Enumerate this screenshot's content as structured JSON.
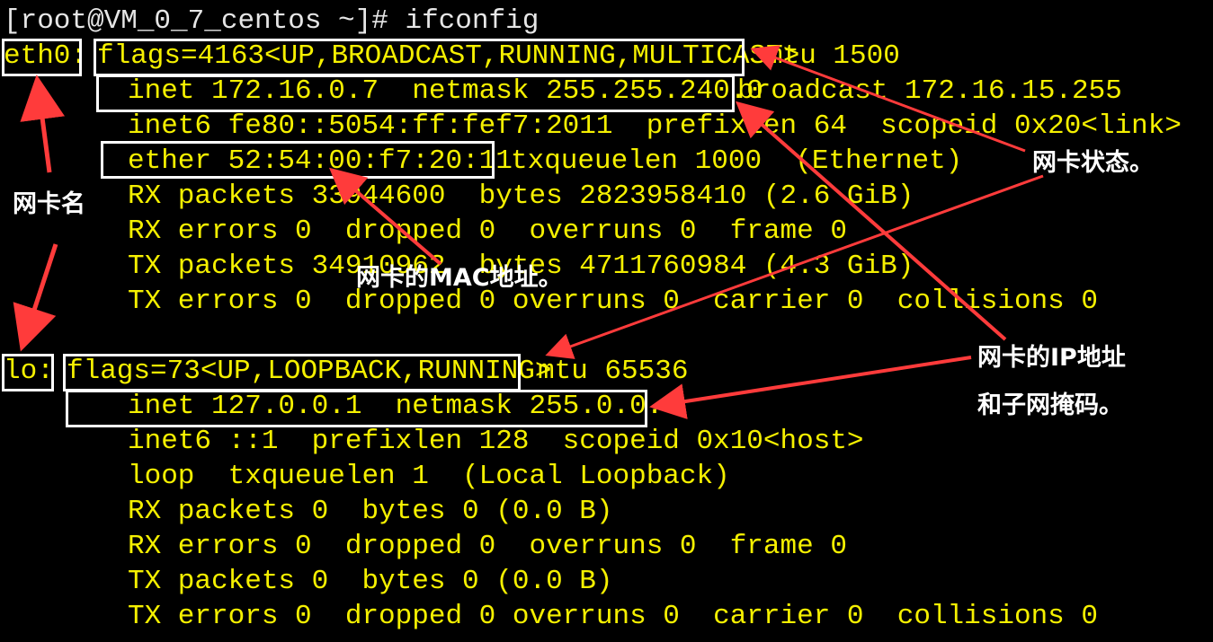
{
  "terminal": {
    "prompt": "[root@VM_0_7_centos ~]# ifconfig",
    "eth0": {
      "name": "eth0:",
      "flags": "flags=4163<UP,BROADCAST,RUNNING,MULTICAST>",
      "mtu": "mtu 1500",
      "inet": "inet 172.16.0.7  netmask 255.255.240.0",
      "broadcast": "broadcast 172.16.15.255",
      "inet6": "inet6 fe80::5054:ff:fef7:2011  prefixlen 64  scopeid 0x20<link>",
      "ether": "ether 52:54:00:f7:20:11",
      "txqueuelen": "txqueuelen 1000  (Ethernet)",
      "rx_packets": "RX packets 33944600  bytes 2823958410 (2.6 GiB)",
      "rx_errors": "RX errors 0  dropped 0  overruns 0  frame 0",
      "tx_packets": "TX packets 34910962  bytes 4711760984 (4.3 GiB)",
      "tx_errors": "TX errors 0  dropped 0 overruns 0  carrier 0  collisions 0"
    },
    "lo": {
      "name": "lo:",
      "flags": "flags=73<UP,LOOPBACK,RUNNING>",
      "mtu": "mtu 65536",
      "inet": "inet 127.0.0.1  netmask 255.0.0.0",
      "inet6": "inet6 ::1  prefixlen 128  scopeid 0x10<host>",
      "loop": "loop  txqueuelen 1  (Local Loopback)",
      "rx_packets": "RX packets 0  bytes 0 (0.0 B)",
      "rx_errors": "RX errors 0  dropped 0  overruns 0  frame 0",
      "tx_packets": "TX packets 0  bytes 0 (0.0 B)",
      "tx_errors": "TX errors 0  dropped 0 overruns 0  carrier 0  collisions 0"
    }
  },
  "annotations": {
    "nic_name": "网卡名",
    "nic_status": "网卡状态。",
    "nic_mac": "网卡的MAC地址。",
    "nic_ip_line1": "网卡的IP地址",
    "nic_ip_line2": "和子网掩码。"
  },
  "colors": {
    "background": "#000000",
    "terminal_text": "#f5f000",
    "prompt_text": "#e6e6e6",
    "highlight_box": "#ffffff",
    "arrow": "#ff3b3b"
  }
}
